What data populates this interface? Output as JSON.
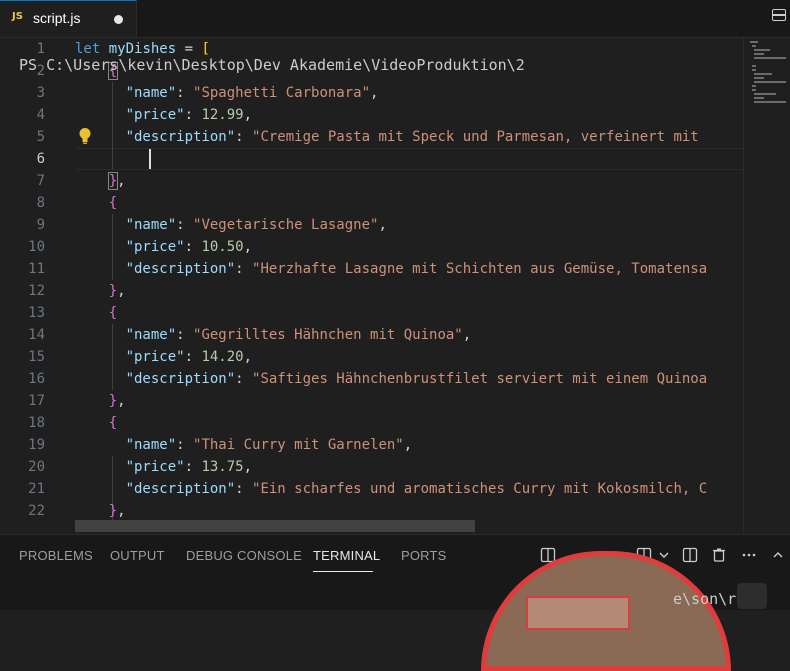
{
  "tab": {
    "lang": "JS",
    "filename": "script.js"
  },
  "editor": {
    "line_numbers": [
      "1",
      "2",
      "3",
      "4",
      "5",
      "6",
      "7",
      "8",
      "9",
      "10",
      "11",
      "12",
      "13",
      "14",
      "15",
      "16",
      "17",
      "18",
      "19",
      "20",
      "21",
      "22"
    ],
    "active_line": "6",
    "code": {
      "l1": {
        "kw": "let",
        "var": "myDishes",
        "op": " = ",
        "br": "["
      },
      "l2": {
        "br": "{"
      },
      "l3": {
        "key": "\"name\"",
        "colon": ": ",
        "val": "\"Spaghetti Carbonara\"",
        "comma": ","
      },
      "l4": {
        "key": "\"price\"",
        "colon": ": ",
        "val": "12.99",
        "comma": ","
      },
      "l5": {
        "key": "\"description\"",
        "colon": ": ",
        "val": "\"Cremige Pasta mit Speck und Parmesan, verfeinert mit"
      },
      "l7": {
        "br": "}",
        "comma": ","
      },
      "l8": {
        "br": "{"
      },
      "l9": {
        "key": "\"name\"",
        "colon": ": ",
        "val": "\"Vegetarische Lasagne\"",
        "comma": ","
      },
      "l10": {
        "key": "\"price\"",
        "colon": ": ",
        "val": "10.50",
        "comma": ","
      },
      "l11": {
        "key": "\"description\"",
        "colon": ": ",
        "val": "\"Herzhafte Lasagne mit Schichten aus Gemüse, Tomatensa"
      },
      "l12": {
        "br": "}",
        "comma": ","
      },
      "l13": {
        "br": "{"
      },
      "l14": {
        "key": "\"name\"",
        "colon": ": ",
        "val": "\"Gegrilltes Hähnchen mit Quinoa\"",
        "comma": ","
      },
      "l15": {
        "key": "\"price\"",
        "colon": ": ",
        "val": "14.20",
        "comma": ","
      },
      "l16": {
        "key": "\"description\"",
        "colon": ": ",
        "val": "\"Saftiges Hähnchenbrustfilet serviert mit einem Quinoa"
      },
      "l17": {
        "br": "}",
        "comma": ","
      },
      "l18": {
        "br": "{"
      },
      "l19": {
        "key": "\"name\"",
        "colon": ": ",
        "val": "\"Thai Curry mit Garnelen\"",
        "comma": ","
      },
      "l20": {
        "key": "\"price\"",
        "colon": ": ",
        "val": "13.75",
        "comma": ","
      },
      "l21": {
        "key": "\"description\"",
        "colon": ": ",
        "val": "\"Ein scharfes und aromatisches Curry mit Kokosmilch, C"
      },
      "l22": {
        "br": "}",
        "comma": ","
      }
    }
  },
  "panel": {
    "tabs": [
      "PROBLEMS",
      "OUTPUT",
      "DEBUG CONSOLE",
      "TERMINAL",
      "PORTS"
    ],
    "active_tab": "TERMINAL",
    "terminal_line": "PS C:\\Users\\kevin\\Desktop\\Dev Akademie\\VideoProduktion\\2",
    "terminal_tail": "e\\son\\rukt"
  },
  "colors": {
    "accent": "#0078d4",
    "keyword": "#569cd6",
    "string": "#ce9178",
    "number": "#b5cea8",
    "property": "#9cdcfe",
    "bracket_gold": "#ffd700",
    "bracket_purple": "#da70d6",
    "webcam_ring": "#e23b3b"
  },
  "icons": [
    "split-editor-icon",
    "lightbulb-icon",
    "terminal-layout-icon",
    "split-terminal-icon",
    "trash-icon",
    "more-icon",
    "chevron-up-icon"
  ]
}
